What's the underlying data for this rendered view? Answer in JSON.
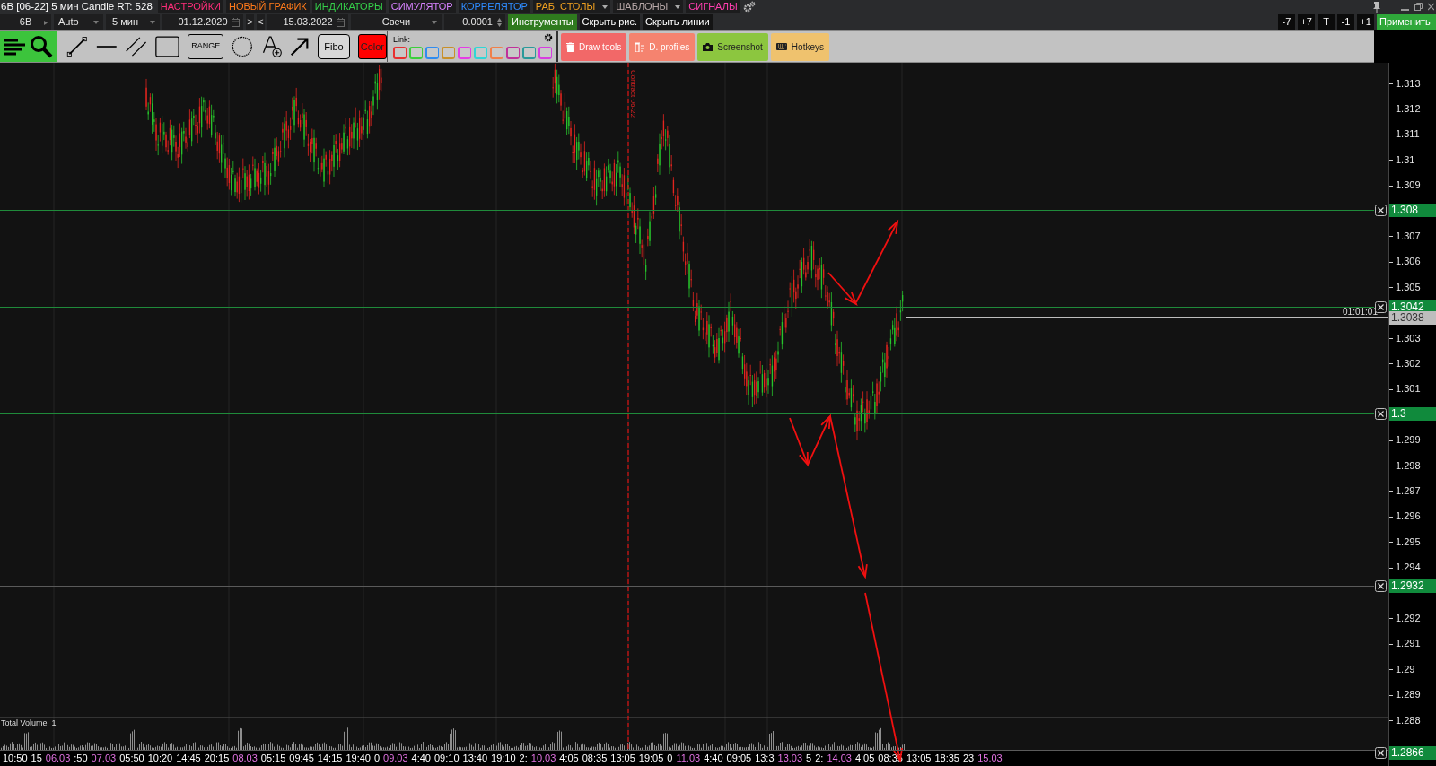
{
  "title": "6B [06-22] 5 мин Candle RT: 528",
  "menu": [
    {
      "label": "НАСТРОЙКИ",
      "color": "#ff2d7a",
      "dropdown": false
    },
    {
      "label": "НОВЫЙ ГРАФИК",
      "color": "#ff7a1a",
      "dropdown": false
    },
    {
      "label": "ИНДИКАТОРЫ",
      "color": "#35d04a",
      "dropdown": false
    },
    {
      "label": "СИМУЛЯТОР",
      "color": "#d782ff",
      "dropdown": false
    },
    {
      "label": "КОРРЕЛЯТОР",
      "color": "#2f8cff",
      "dropdown": false
    },
    {
      "label": "РАБ. СТОЛЫ",
      "color": "#f0a020",
      "dropdown": true
    },
    {
      "label": "ШАБЛОНЫ",
      "color": "#b8a8a8",
      "dropdown": true
    },
    {
      "label": "СИГНАЛЫ",
      "color": "#ff3fb0",
      "dropdown": false
    }
  ],
  "controls": {
    "symbol": "6B",
    "scale": "Auto",
    "timeframe": "5 мин",
    "date_from": "01.12.2020",
    "next": ">",
    "prev": "<",
    "date_to": "15.03.2022",
    "chart_type": "Свечи",
    "step": "0.0001",
    "buttons": [
      {
        "label": "Инструменты",
        "kind": "accent"
      },
      {
        "label": "Скрыть рис.",
        "kind": "plain"
      },
      {
        "label": "Скрыть линии",
        "kind": "plain"
      }
    ]
  },
  "shift_buttons": [
    "-7",
    "+7",
    "T",
    "-1",
    "+1"
  ],
  "apply_button": "Применить",
  "toolbar": {
    "range_button": "RANGE",
    "fibo_button": "Fibo",
    "color_button": "Color"
  },
  "link": {
    "label": "Link:",
    "buttons": [
      {
        "color": "#e83030"
      },
      {
        "color": "#3ccf3c"
      },
      {
        "color": "#2f8cf0"
      },
      {
        "color": "#c8902a"
      },
      {
        "color": "#e63ce6"
      },
      {
        "color": "#2fd6d6"
      },
      {
        "color": "#f0804a"
      },
      {
        "color": "#c0309a"
      },
      {
        "color": "#2a9a9a"
      },
      {
        "color": "#d83ce0"
      }
    ]
  },
  "actions": [
    {
      "label": "Draw tools",
      "color": "#f26868",
      "kind": "delete"
    },
    {
      "label": "D. profiles",
      "color": "#f5836f",
      "kind": "profiles"
    },
    {
      "label": "Screenshot",
      "color": "#8cc63f",
      "kind": "camera"
    },
    {
      "label": "Hotkeys",
      "color": "#efc26e",
      "kind": "keyboard"
    }
  ],
  "chart": {
    "marker_label": "Contract 06-22",
    "volume_label": "Total Volume_1",
    "price_ticks": [
      "1.313",
      "1.312",
      "1.311",
      "1.31",
      "1.309",
      "1.307",
      "1.306",
      "1.305",
      "1.303",
      "1.302",
      "1.301",
      "1.299",
      "1.298",
      "1.297",
      "1.296",
      "1.295",
      "1.294",
      "1.292",
      "1.291",
      "1.29",
      "1.289",
      "1.288"
    ],
    "levels": [
      {
        "label": "1.308",
        "kind": "level",
        "color": "#1f8a3a"
      },
      {
        "label": "1.3042",
        "kind": "level",
        "color": "#1f8a3a"
      },
      {
        "label": "1.3038",
        "kind": "current",
        "color": "#bdbdbd",
        "timer": "01:01:01"
      },
      {
        "label": "1.3",
        "kind": "level",
        "color": "#1f8a3a"
      },
      {
        "label": "1.2932",
        "kind": "level",
        "color": "#5a5a5a"
      },
      {
        "label": "1.2866",
        "kind": "level",
        "color": "#5a5a5a"
      }
    ],
    "time_labels": [
      {
        "label": "10:50",
        "kind": "time"
      },
      {
        "label": "15",
        "kind": "time"
      },
      {
        "label": "06.03",
        "kind": "date"
      },
      {
        "label": ":50",
        "kind": "time"
      },
      {
        "label": "07.03",
        "kind": "date"
      },
      {
        "label": "05:50",
        "kind": "time"
      },
      {
        "label": "10:20",
        "kind": "time"
      },
      {
        "label": "14:45",
        "kind": "time"
      },
      {
        "label": "20:15",
        "kind": "time"
      },
      {
        "label": "08.03",
        "kind": "date"
      },
      {
        "label": "05:15",
        "kind": "time"
      },
      {
        "label": "09:45",
        "kind": "time"
      },
      {
        "label": "14:15",
        "kind": "time"
      },
      {
        "label": "19:40",
        "kind": "time"
      },
      {
        "label": "0",
        "kind": "time"
      },
      {
        "label": "09.03",
        "kind": "date"
      },
      {
        "label": "4:40",
        "kind": "time"
      },
      {
        "label": "09:10",
        "kind": "time"
      },
      {
        "label": "13:40",
        "kind": "time"
      },
      {
        "label": "19:10",
        "kind": "time"
      },
      {
        "label": "2:",
        "kind": "time"
      },
      {
        "label": "10.03",
        "kind": "date"
      },
      {
        "label": "4:05",
        "kind": "time"
      },
      {
        "label": "08:35",
        "kind": "time"
      },
      {
        "label": "13:05",
        "kind": "time"
      },
      {
        "label": "19:05",
        "kind": "time"
      },
      {
        "label": "0",
        "kind": "time"
      },
      {
        "label": "11.03",
        "kind": "date"
      },
      {
        "label": "4:40",
        "kind": "time"
      },
      {
        "label": "09:05",
        "kind": "time"
      },
      {
        "label": "13:3",
        "kind": "time"
      },
      {
        "label": "13.03",
        "kind": "date"
      },
      {
        "label": "5",
        "kind": "time"
      },
      {
        "label": "2:",
        "kind": "time"
      },
      {
        "label": "14.03",
        "kind": "date"
      },
      {
        "label": "4:05",
        "kind": "time"
      },
      {
        "label": "08:35",
        "kind": "time"
      },
      {
        "label": "13:05",
        "kind": "time"
      },
      {
        "label": "18:35",
        "kind": "time"
      },
      {
        "label": "23",
        "kind": "time"
      },
      {
        "label": "15.03",
        "kind": "date"
      }
    ]
  }
}
